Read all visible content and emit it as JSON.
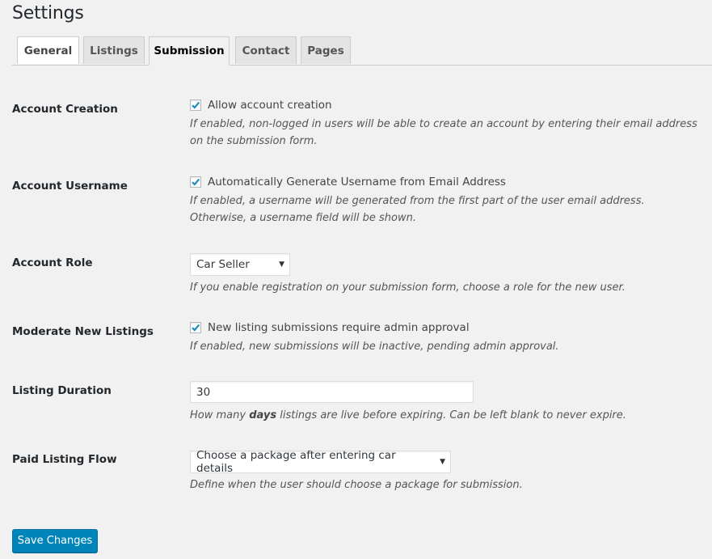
{
  "page": {
    "title": "Settings"
  },
  "tabs": [
    {
      "label": "General",
      "state": "hover"
    },
    {
      "label": "Listings",
      "state": "inactive"
    },
    {
      "label": "Submission",
      "state": "active"
    },
    {
      "label": "Contact",
      "state": "inactive"
    },
    {
      "label": "Pages",
      "state": "inactive"
    }
  ],
  "settings": {
    "account_creation": {
      "label": "Account Creation",
      "checkbox_label": "Allow account creation",
      "checked": true,
      "description": "If enabled, non-logged in users will be able to create an account by entering their email address on the submission form."
    },
    "account_username": {
      "label": "Account Username",
      "checkbox_label": "Automatically Generate Username from Email Address",
      "checked": true,
      "description": "If enabled, a username will be generated from the first part of the user email address. Otherwise, a username field will be shown."
    },
    "account_role": {
      "label": "Account Role",
      "selected": "Car Seller",
      "description": "If you enable registration on your submission form, choose a role for the new user."
    },
    "moderate_listings": {
      "label": "Moderate New Listings",
      "checkbox_label": "New listing submissions require admin approval",
      "checked": true,
      "description": "If enabled, new submissions will be inactive, pending admin approval."
    },
    "listing_duration": {
      "label": "Listing Duration",
      "value": "30",
      "description_pre": "How many ",
      "description_bold": "days",
      "description_post": " listings are live before expiring. Can be left blank to never expire."
    },
    "paid_listing_flow": {
      "label": "Paid Listing Flow",
      "selected": "Choose a package after entering car details",
      "description": "Define when the user should choose a package for submission."
    }
  },
  "actions": {
    "save_label": "Save Changes"
  },
  "icons": {
    "checkmark": "checkmark-icon",
    "dropdown": "▼"
  },
  "colors": {
    "accent": "#0085ba",
    "check": "#1e8cbe",
    "background": "#f1f1f1"
  }
}
